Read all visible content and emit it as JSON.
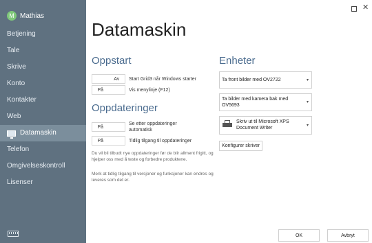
{
  "user": {
    "initial": "M",
    "name": "Mathias"
  },
  "sidebar": {
    "items": [
      {
        "label": "Betjening"
      },
      {
        "label": "Tale"
      },
      {
        "label": "Skrive"
      },
      {
        "label": "Konto"
      },
      {
        "label": "Kontakter"
      },
      {
        "label": "Web"
      },
      {
        "label": "Datamaskin",
        "active": true
      },
      {
        "label": "Telefon"
      },
      {
        "label": "Omgivelseskontroll"
      },
      {
        "label": "Lisenser"
      }
    ]
  },
  "window": {
    "restore_icon": "restore-icon",
    "close_symbol": "✕"
  },
  "page": {
    "title": "Datamaskin"
  },
  "startup": {
    "title": "Oppstart",
    "options": [
      {
        "state_left": "",
        "state_right": "Av",
        "label": "Start Grid3 når Windows starter"
      },
      {
        "state_left": "På",
        "state_right": "",
        "label": "Vis menylinje (F12)"
      }
    ]
  },
  "updates": {
    "title": "Oppdateringer",
    "options": [
      {
        "state_left": "På",
        "state_right": "",
        "label": "Se etter oppdateringer automatisk"
      },
      {
        "state_left": "På",
        "state_right": "",
        "label": "Tidlig tilgang til oppdateringer"
      }
    ],
    "info1": "Du vil bli tilbudt nye oppdateringer før de blir allment frigitt, og hjelper oss med å teste og forbedre produktene.",
    "info2": "Merk at tidlig tilgang til versjoner og funksjoner kan endres og leveres som det er."
  },
  "devices": {
    "title": "Enheter",
    "front_camera": "Ta front bilder med OV2722",
    "back_camera": "Ta bilder med kamera bak med OV5693",
    "printer": "Skriv ut til Microsoft XPS Document Writer",
    "configure_printer": "Konfigurer skriver"
  },
  "footer": {
    "ok": "OK",
    "cancel": "Avbryt"
  },
  "colors": {
    "sidebar": "#5f7180",
    "active": "#7b8e9c",
    "section_title": "#4b6c8f"
  }
}
